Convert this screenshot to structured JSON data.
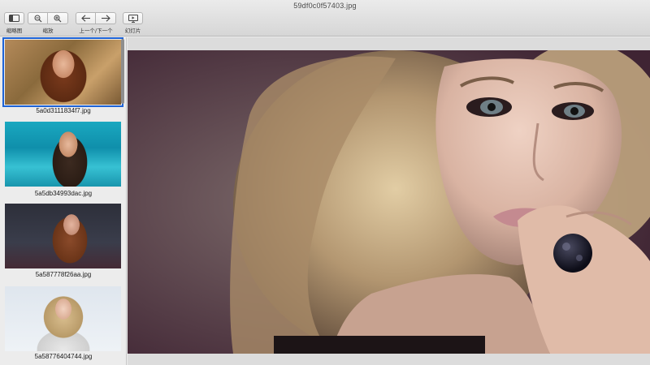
{
  "window": {
    "title": "59df0c0f57403.jpg"
  },
  "toolbar": {
    "sidebar_label": "缩略图",
    "zoom_label": "缩放",
    "nav_label": "上一个/下一个",
    "slideshow_label": "幻灯片",
    "icons": {
      "sidebar": "sidebar-icon",
      "zoom_out": "zoom-out-icon",
      "zoom_in": "zoom-in-icon",
      "prev": "arrow-left-icon",
      "next": "arrow-right-icon",
      "slideshow": "slideshow-icon"
    }
  },
  "sidebar": {
    "items": [
      {
        "name": "5a0d3111834f7.jpg",
        "selected": true
      },
      {
        "name": "5a5db34993dac.jpg",
        "selected": false
      },
      {
        "name": "5a587778f26aa.jpg",
        "selected": false
      },
      {
        "name": "5a58776404744.jpg",
        "selected": false
      }
    ]
  },
  "colors": {
    "selection": "#1e63d6",
    "window_bg": "#ececec"
  }
}
